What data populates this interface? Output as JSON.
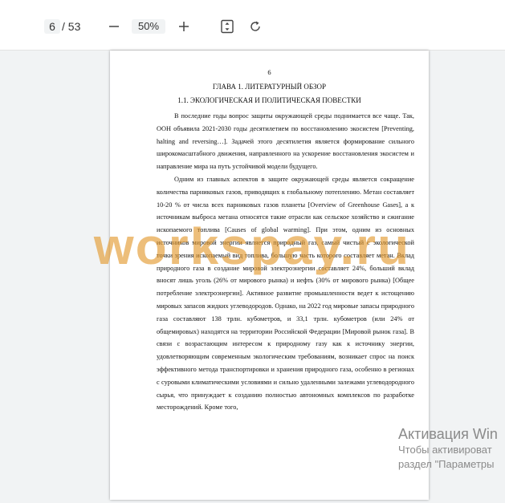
{
  "toolbar": {
    "current_page": "6",
    "page_total": "/ 53",
    "zoom": "50%",
    "icons": [
      "minus-icon",
      "plus-icon",
      "fit-page-icon",
      "rotate-icon"
    ]
  },
  "document": {
    "page_number": "6",
    "chapter_title": "ГЛАВА 1. ЛИТЕРАТУРНЫЙ ОБЗОР",
    "section_title": "1.1. ЭКОЛОГИЧЕСКАЯ И ПОЛИТИЧЕСКАЯ ПОВЕСТКИ",
    "paragraphs": [
      "В последние годы вопрос защиты окружающей среды поднимается все чаще. Так, ООН объявила 2021-2030 годы десятилетием по восстановлению экосистем [Preventing, halting and reversing…]. Задачей этого десятилетия является формирование сильного широкомасштабного движения, направленного на ускорение восстановления экосистем и направление мира на путь устойчивой модели будущего.",
      "Одним из главных аспектов в защите окружающей среды является сокращение количества парниковых газов, приводящих к глобальному потеплению. Метан составляет 10-20 % от числа всех парниковых газов планеты [Overview of Greenhouse Gases], а к источникам выброса метана относятся такие отрасли как сельское хозяйство и сжигание ископаемого топлива [Causes of global warming]. При этом, одним из основных источников мировой энергии является природный газ, самый чистый с экологической точки зрения ископаемый вид топлива, большую часть которого составляет метан. Вклад природного газа в создание мировой электроэнергии составляет 24%, больший вклад вносят лишь уголь (26% от мирового рынка) и нефть (30% от мирового рынка) [Общее потребление электроэнергии]. Активное развитие промышленности ведет к истощению мировых запасов жидких углеводородов. Однако, на 2022 год мировые запасы природного газа составляют 138 трлн. кубометров, и 33,1 трлн. кубометров (или 24% от общемировых) находятся на территории Российской Федерации [Мировой рынок газа]. В связи с возрастающим интересом к природному газу как к источнику энергии, удовлетворяющим современным экологическим требованиям, возникает спрос на поиск эффективного метода транспортировки и хранения природного газа, особенно в регионах с суровыми климатическими условиями и сильно удаленными залежами углеводородного сырья, что принуждает к созданию полностью автономных комплексов по разработке месторождений. Кроме того,"
    ]
  },
  "watermark": "workspay.ru",
  "os_activation": {
    "title": "Активация Win",
    "line1": "Чтобы активироват",
    "line2": "раздел \"Параметры"
  }
}
